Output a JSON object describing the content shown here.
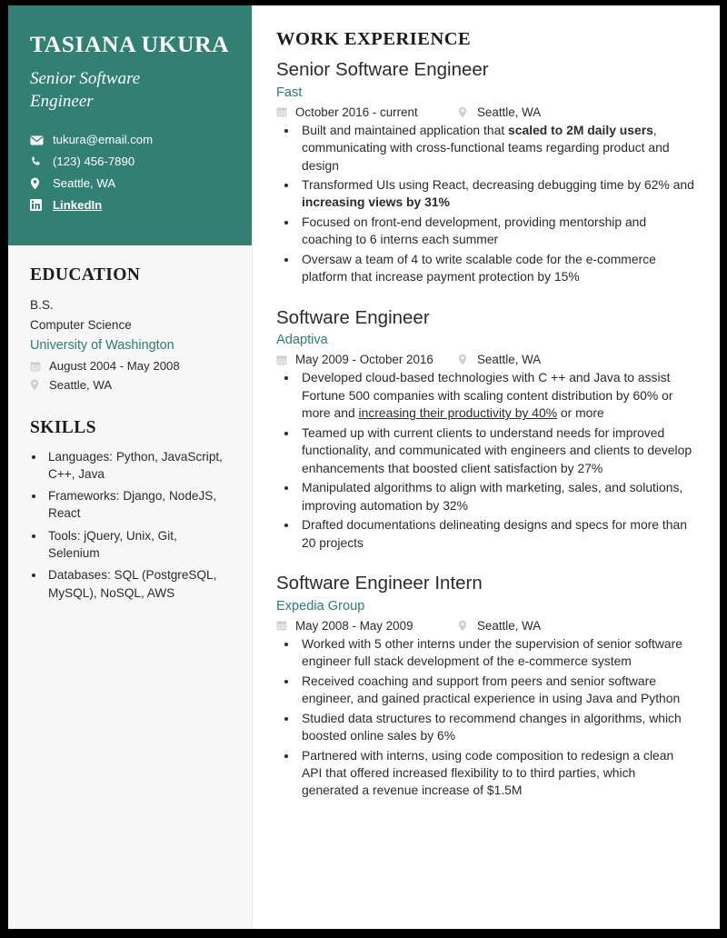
{
  "sidebar": {
    "name": "TASIANA UKURA",
    "title": "Senior Software Engineer",
    "contacts": [
      {
        "icon": "envelope-icon",
        "text": "tukura@email.com",
        "link": false
      },
      {
        "icon": "phone-icon",
        "text": "(123) 456-7890",
        "link": false
      },
      {
        "icon": "map-pin-icon",
        "text": "Seattle, WA",
        "link": false
      },
      {
        "icon": "linkedin-icon",
        "text": "LinkedIn",
        "link": true
      }
    ],
    "education": {
      "heading": "EDUCATION",
      "degree": "B.S.",
      "field": "Computer Science",
      "school": "University of Washington",
      "dates": "August 2004 - May 2008",
      "location": "Seattle, WA"
    },
    "skills": {
      "heading": "SKILLS",
      "items": [
        "Languages: Python, JavaScript, C++, Java",
        "Frameworks: Django, NodeJS, React",
        "Tools: jQuery, Unix, Git, Selenium",
        "Databases: SQL (PostgreSQL, MySQL), NoSQL, AWS"
      ]
    }
  },
  "main": {
    "heading": "WORK EXPERIENCE",
    "jobs": [
      {
        "role": "Senior Software Engineer",
        "company": "Fast",
        "dates": "October 2016 - current",
        "location": "Seattle, WA",
        "bullets": [
          "Built and maintained application that <b>scaled to 2M daily users</b>, communicating with cross-functional teams regarding product and design",
          "Transformed UIs using React, decreasing debugging time by 62% and <b>increasing views by 31%</b>",
          "Focused on front-end development, providing mentorship and coaching to 6 interns each summer",
          "Oversaw a team of 4 to write scalable code for the e-commerce platform that increase payment protection by 15%"
        ]
      },
      {
        "role": "Software Engineer",
        "company": "Adaptiva",
        "dates": "May 2009 - October 2016",
        "location": "Seattle, WA",
        "bullets": [
          "Developed cloud-based technologies with C ++ and Java to assist Fortune 500 companies with scaling content distribution by 60% or more and <u>increasing their productivity by 40%</u> or more",
          "Teamed up with current clients to understand needs for improved functionality, and communicated with engineers and clients to develop enhancements that boosted client satisfaction by 27%",
          "Manipulated algorithms to align with marketing, sales, and solutions, improving automation by 32%",
          "Drafted documentations delineating designs and specs for more than 20 projects"
        ]
      },
      {
        "role": "Software Engineer Intern",
        "company": "Expedia Group",
        "dates": "May 2008 - May 2009",
        "location": "Seattle, WA",
        "bullets": [
          "Worked with 5 other interns under the supervision of senior software engineer full stack development of the e-commerce system",
          "Received coaching and support from peers and senior software engineer, and gained practical experience in using Java and Python",
          "Studied data structures to recommend changes in algorithms, which boosted online sales by 6%",
          "Partnered with interns, using code composition to redesign a clean API that offered increased flexibility to to third parties, which generated a revenue increase of $1.5M"
        ]
      }
    ]
  },
  "colors": {
    "header_teal": "#328073",
    "accent_green": "#2d7d6e",
    "sidebar_gray": "#f7f7f7",
    "text_dark": "#2b2b2b"
  }
}
